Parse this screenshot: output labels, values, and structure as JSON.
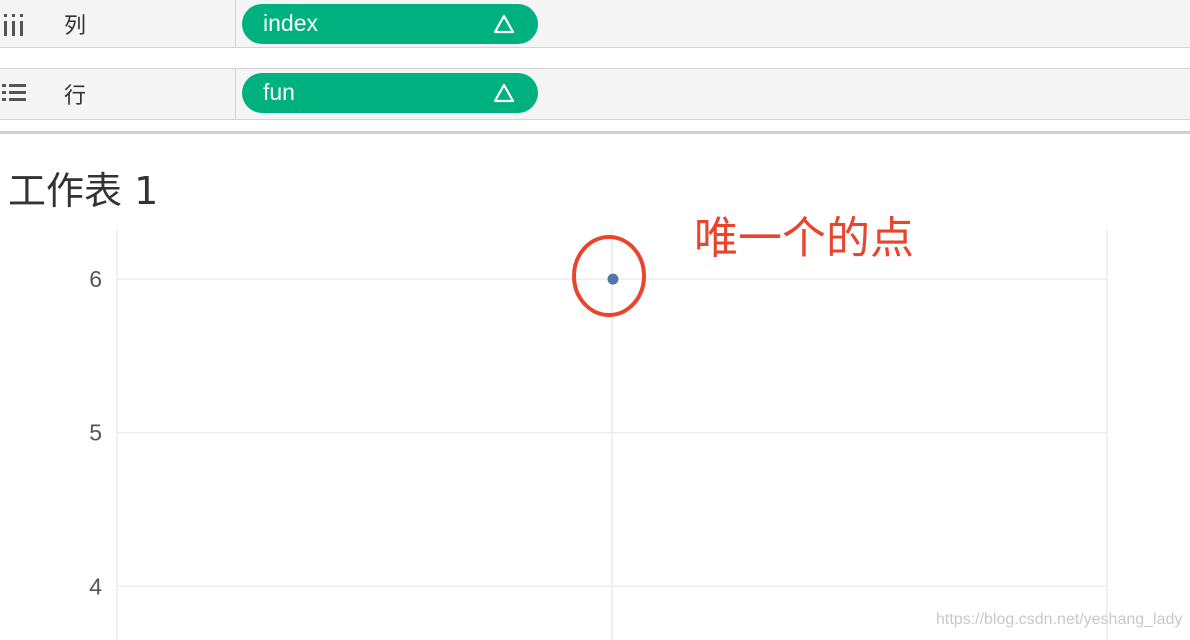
{
  "shelves": {
    "columns": {
      "label": "列",
      "icon": "columns-icon",
      "pill": {
        "field": "index",
        "marker": "Δ"
      }
    },
    "rows": {
      "label": "行",
      "icon": "rows-icon",
      "pill": {
        "field": "fun",
        "marker": "Δ"
      }
    }
  },
  "sheet": {
    "title": "工作表 1"
  },
  "annotation": {
    "text": "唯一个的点",
    "color": "#e8452c"
  },
  "watermark": "https://blog.csdn.net/yeshang_lady",
  "colors": {
    "pill": "#00b180",
    "point": "#4e79a7",
    "grid": "#ececec"
  },
  "chart_data": {
    "type": "scatter",
    "x": [],
    "points": [
      {
        "y": 6
      }
    ],
    "y_ticks": [
      "6",
      "5",
      "4"
    ],
    "ylim": [
      3.65,
      6.32
    ],
    "grid": true,
    "annotation_circle": true
  }
}
